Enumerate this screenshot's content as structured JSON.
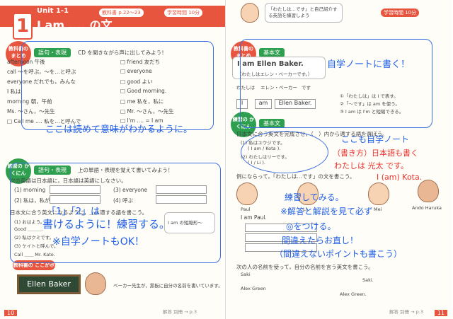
{
  "left_page": {
    "unit_number": "1",
    "unit_label": "Unit 1-1",
    "unit_title": "I am .... の文",
    "textbook_ref": "教科書 p.22〜23",
    "study_time": "学習時間 10分",
    "summary_badge": "教科書の まとめ",
    "summary_tab": "語句・表現",
    "summary_note": "CD を聞きながら声に出してみよう！",
    "vocab_left": [
      "afternoon 午後",
      "call 〜を呼ぶ，〜を…と呼ぶ",
      "everyone だれでも，みんな",
      "I 私は",
      "morning 朝，午前",
      "Ms. 〜さん，〜先生",
      "□ Call me .... 私を…と呼んで"
    ],
    "vocab_right": [
      "□ friend 友だち",
      "□ everyone",
      "□ good よい",
      "□ Good morning.",
      "□ me 私を，私に",
      "□ Mr. 〜さん，〜先生",
      "□ I'm .... = I am"
    ],
    "check_badge": "練習の かくにん",
    "check_tab": "語句・表現",
    "check_note": "上の単語・表現を覚えて書いてみよう！",
    "q1_text": "次の英語は日本語に，日本語は英語にしなさい。",
    "q1_items": [
      "(1) morning",
      "(2) 私は，私が",
      "(3) everyone",
      "(4) 呼ぶ"
    ],
    "q2_text": "日本文に合う英文になるように，＿に適する語を書こう。",
    "q2_items": [
      "(1) おはよう。",
      "Good ＿＿＿.",
      "(2) 私はクミです。",
      "(3) ケイトと呼んで。",
      "Call ＿＿ Mr. Kato."
    ],
    "hint_box": "I am の短縮形〜",
    "pickup_badge": "教科書の ここがポイント",
    "chalk_text": "Ellen Baker",
    "pickup_note": "ベーカー先生が，黒板に自分の名前を書いています。",
    "footer": "解答 別冊 → p.3",
    "page_no": "10"
  },
  "right_page": {
    "bubble_text": "「わたしは…です」と自己紹介する英語を練習しよう",
    "study_time": "学習時間 10分",
    "summary_badge": "教科書の まとめ",
    "summary_tab": "基本文",
    "example": "I am Ellen Baker.",
    "example_jp": "（わたしはエレン・ベーカーです。）",
    "diagram": [
      "わたしは",
      "エレン・ベーカー",
      "です",
      "I",
      "am",
      "Ellen Baker."
    ],
    "notes": [
      "①「わたしは」は I で表す。",
      "②「〜です」は am を使う。",
      "③ I am は I'm と短縮できる。"
    ],
    "check_badge": "練習の かくにん",
    "check_tab": "基本文",
    "q1_text": "日本文に合う英文を完成させ，（　）内から適する語を選ぼう。",
    "q1_items": [
      "(1) 私はユウジです。",
      "( I am / Kota ).",
      "(2) わたしはリーです。",
      "( I / Li )."
    ],
    "q2_text": "例にならって，「わたしは…です」の文を書こう。",
    "names": [
      "Paul",
      "Li",
      "Mei",
      "Ando Haruka"
    ],
    "example_sentence": "I am Paul.",
    "q3_text": "次の人の名前を使って，自分の名前を言う英文を書こう。",
    "q3_names": [
      "Saki",
      "Alex Green",
      "Saki.",
      "Alex Green."
    ],
    "footer": "解答 別冊 → p.3",
    "page_no": "11"
  },
  "annotations": {
    "a1": "自学ノートに書く！",
    "a2": "ここは読めて意味がわかるように。",
    "a3": "ここも自学ノート",
    "a4": "（書き方）日本語も書く",
    "a5": "わたしは 光太 です。",
    "a6": "I (am) Kota.",
    "a7": "「1」「2」は",
    "a8": "書けるように！練習する。",
    "a9": "※自学ノートもOK！",
    "a10": "練習してみる。",
    "a11": "※解答と解説を見て必ず",
    "a12": "◎をつける。",
    "a13": "間違えたらお直し！",
    "a14": "（間違えないポイントも書こう）"
  }
}
